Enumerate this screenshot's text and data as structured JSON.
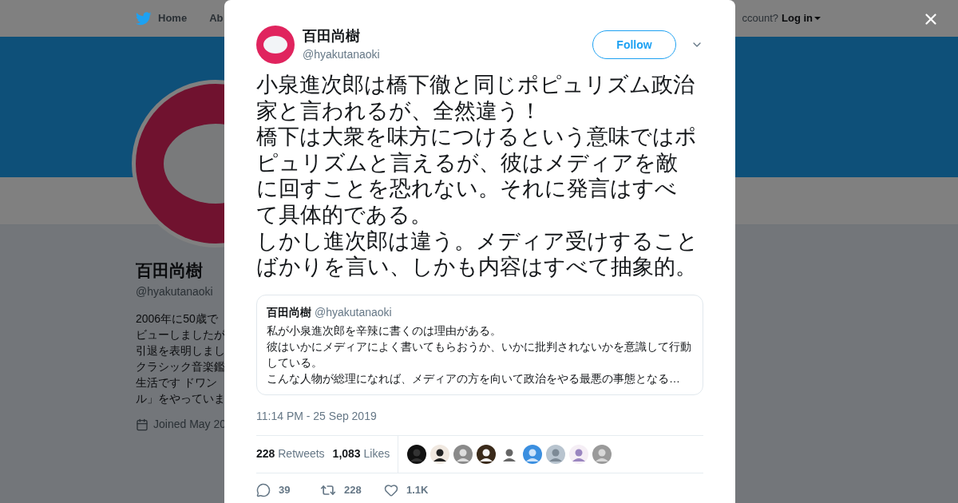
{
  "nav": {
    "items": [
      "Home",
      "Ab"
    ],
    "login_prompt": "ccount?",
    "login": "Log in"
  },
  "profile": {
    "name": "百田尚樹",
    "handle": "@hyakutanaoki",
    "bio_lines": [
      "2006年に50歳で",
      "ビューしましたが",
      "引退を表明しまし",
      "クラシック音楽鑑",
      "生活です ドワン",
      "ル」をやっていま"
    ],
    "joined": "Joined May 20"
  },
  "tweet": {
    "name": "百田尚樹",
    "handle": "@hyakutanaoki",
    "follow": "Follow",
    "text_lines": [
      "小泉進次郎は橋下徹と同じポピュリズム政治",
      "家と言われるが、全然違う！",
      "橋下は大衆を味方につけるという意味ではポ",
      "ピュリズムと言えるが、彼はメディアを敵",
      "に回すことを恐れない。それに発言はすべ",
      "て具体的である。",
      "しかし進次郎は違う。メディア受けすること",
      "ばかりを言い、しかも内容はすべて抽象的。"
    ],
    "quote": {
      "name": "百田尚樹",
      "handle": "@hyakutanaoki",
      "text_lines": [
        "私が小泉進次郎を辛辣に書くのは理由がある。",
        "彼はいかにメディアによく書いてもらおうか、いかに批判されないかを意識して行動",
        "している。",
        "こんな人物が総理になれば、メディアの方を向いて政治をやる最悪の事態となる…"
      ]
    },
    "timestamp": "11:14 PM - 25 Sep 2019",
    "stats": [
      {
        "count": "228",
        "label": "Retweets"
      },
      {
        "count": "1,083",
        "label": "Likes"
      }
    ],
    "actions": [
      {
        "kind": "reply",
        "count": "39"
      },
      {
        "kind": "retweet",
        "count": "228"
      },
      {
        "kind": "like",
        "count": "1.1K"
      }
    ]
  }
}
